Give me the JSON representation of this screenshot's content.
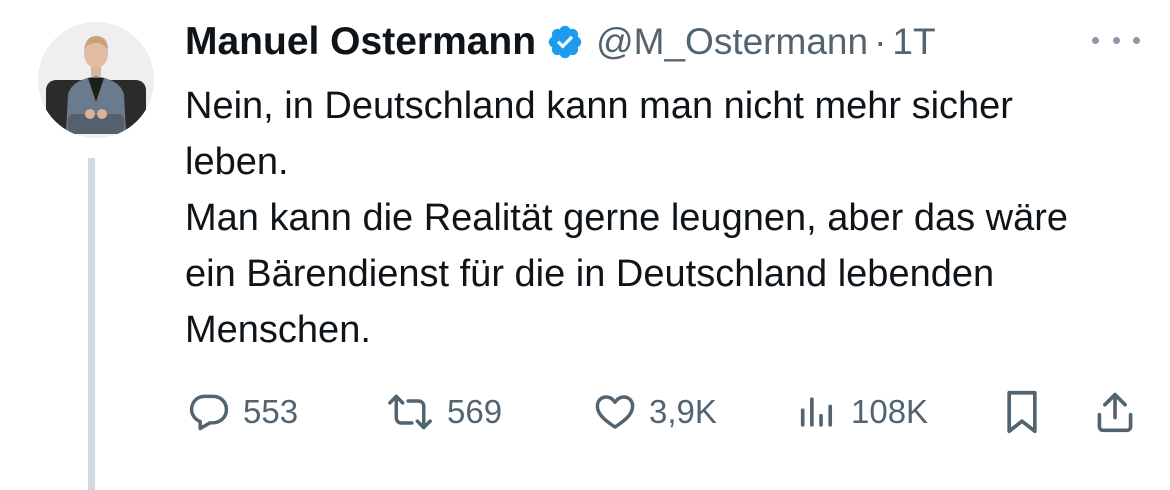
{
  "tweet": {
    "author": {
      "display_name": "Manuel Ostermann",
      "handle": "@M_Ostermann",
      "verified": true
    },
    "separator": "·",
    "timestamp": "1T",
    "text_lines": [
      "Nein, in Deutschland kann man nicht mehr sicher leben.",
      "Man kann die Realität gerne leugnen, aber das wäre ein Bärendienst für die in Deutschland lebenden Menschen."
    ],
    "metrics": {
      "replies": "553",
      "retweets": "569",
      "likes": "3,9K",
      "views": "108K"
    }
  },
  "icons": {
    "verified": "verified-badge-icon",
    "more": "more-options-icon",
    "reply": "reply-icon",
    "retweet": "retweet-icon",
    "like": "heart-icon",
    "views": "views-icon",
    "bookmark": "bookmark-icon",
    "share": "share-icon"
  },
  "colors": {
    "text": "#0f1419",
    "secondary": "#536471",
    "verified": "#1d9bf0",
    "thread_line": "#cfd9de"
  }
}
